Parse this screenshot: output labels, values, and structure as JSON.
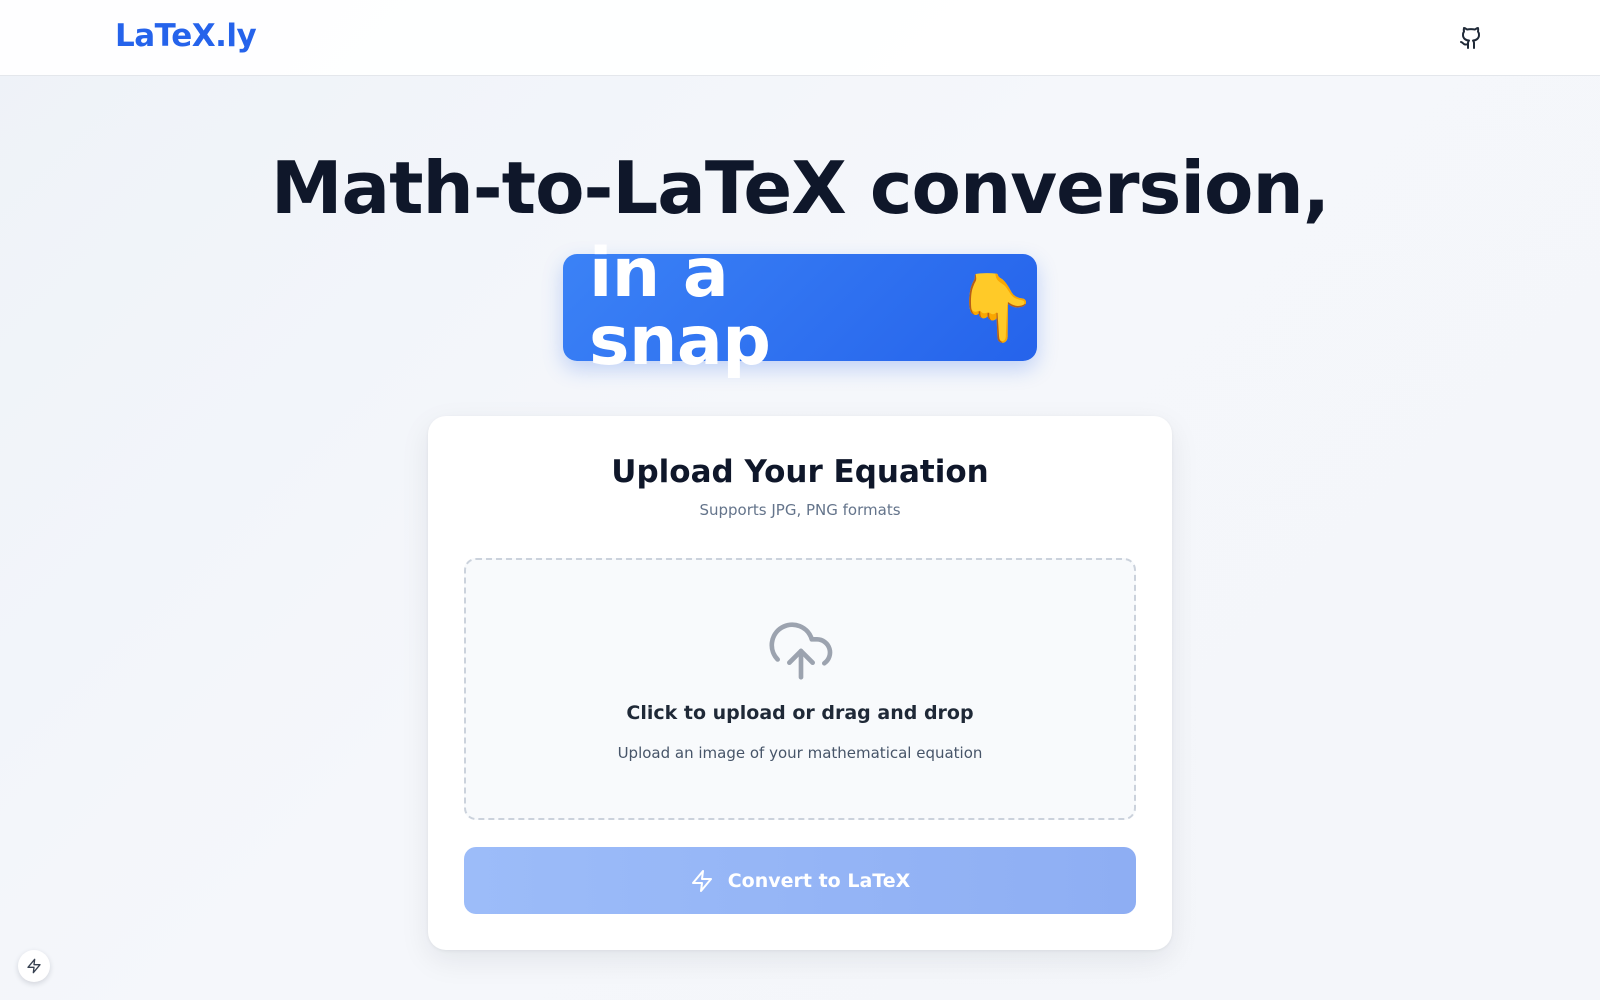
{
  "header": {
    "logo": "LaTeX.ly",
    "github_icon": "github-icon"
  },
  "hero": {
    "title": "Math-to-LaTeX conversion,",
    "highlight": "in a snap",
    "highlight_emoji": "👇"
  },
  "upload_card": {
    "title": "Upload Your Equation",
    "subtitle": "Supports JPG, PNG formats",
    "dropzone": {
      "icon": "cloud-upload-icon",
      "title": "Click to upload or drag and drop",
      "subtitle": "Upload an image of your mathematical equation"
    },
    "convert_button": {
      "icon": "bolt-icon",
      "label": "Convert to LaTeX"
    }
  },
  "floating_button_icon": "bolt-icon",
  "colors": {
    "brand": "#2563eb",
    "brand_light": "#3b82f6",
    "button_disabled": "#9cbcf9",
    "heading": "#0f172a",
    "muted": "#64748b"
  }
}
